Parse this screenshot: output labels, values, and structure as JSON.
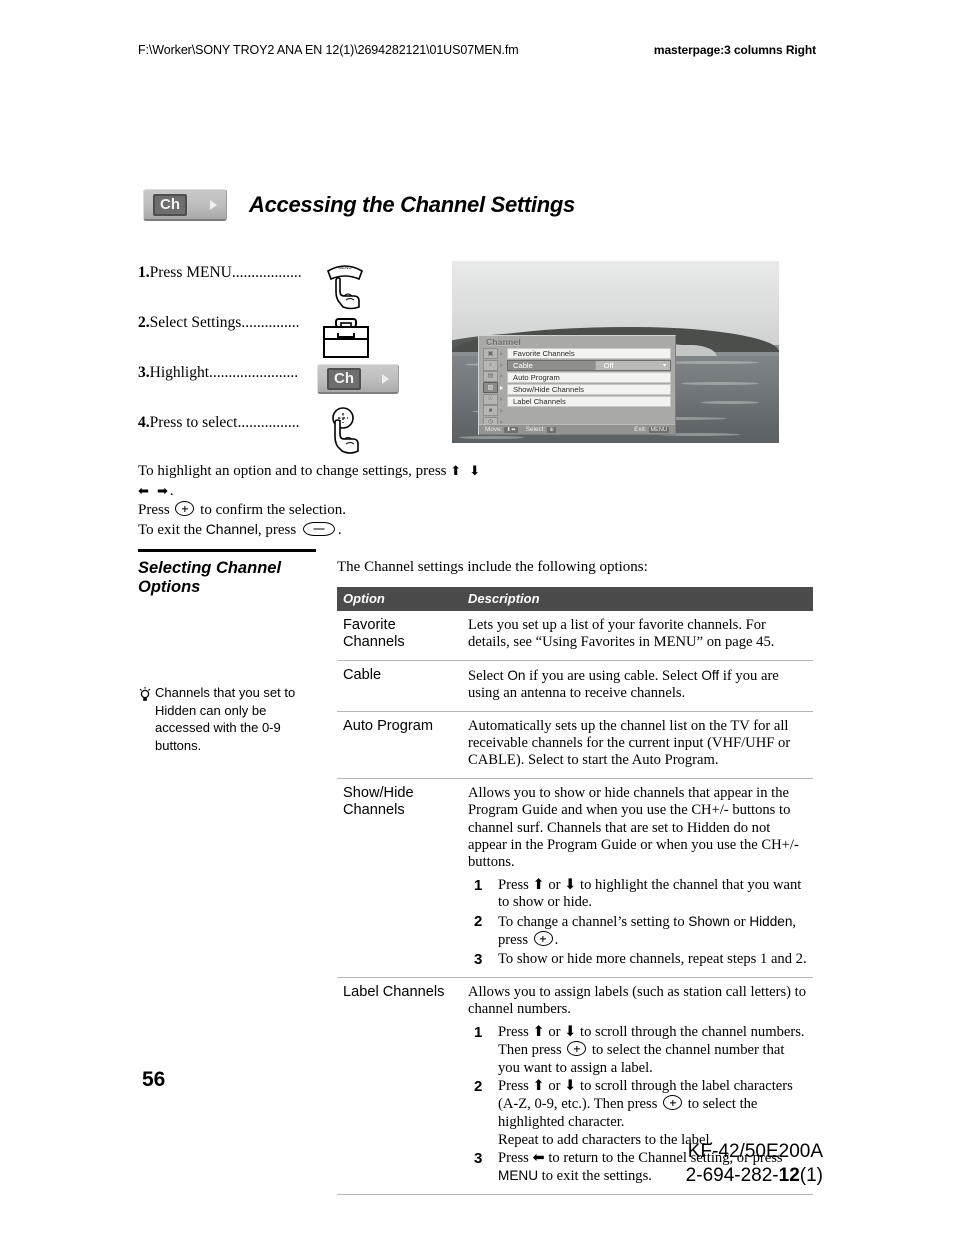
{
  "header": {
    "file_path": "F:\\Worker\\SONY TROY2 ANA EN 12(1)\\2694282121\\01US07MEN.fm",
    "masterpage": "masterpage:3 columns Right"
  },
  "section": {
    "tab_label": "Ch",
    "title": "Accessing the Channel Settings"
  },
  "steps": [
    {
      "num": "1.",
      "text": "Press MENU..................",
      "icon": "hand-pressing-menu-button-icon"
    },
    {
      "num": "2.",
      "text": "Select Settings...............",
      "icon": "toolbox-icon"
    },
    {
      "num": "3.",
      "text": "Highlight.......................",
      "icon": "ch-tab-icon"
    },
    {
      "num": "4.",
      "text": "Press to select................",
      "icon": "hand-pressing-select-button-icon"
    }
  ],
  "tv_screen": {
    "osd": {
      "title": "Channel",
      "rail_icons": [
        "picture-icon",
        "audio-icon",
        "screen-icon",
        "channel-icon",
        "parental-lock-icon",
        "setup-icon",
        "clock-timer-icon"
      ],
      "rail_selected_index": 3,
      "rows": [
        {
          "label": "Favorite Channels",
          "value": "",
          "highlighted": false
        },
        {
          "label": "Cable",
          "value": "Off",
          "highlighted": true
        },
        {
          "label": "Auto Program",
          "value": "",
          "highlighted": false
        },
        {
          "label": "Show/Hide Channels",
          "value": "",
          "highlighted": false
        },
        {
          "label": "Label Channels",
          "value": "",
          "highlighted": false
        }
      ],
      "status_bar": {
        "move": "Move:",
        "move_keys": "⬍⬌",
        "select": "Select:",
        "select_key": "⊕",
        "exit": "Exit:",
        "exit_key": "MENU"
      }
    }
  },
  "instructions": {
    "line1_a": "To highlight an option and to change settings, press ",
    "line1_arrows": "⬆ ⬇ ⬅ ➡",
    "line1_b": ".",
    "line2_a": "Press ",
    "line2_b": " to confirm the selection.",
    "line3_a": "To exit the ",
    "line3_emph": "Channel",
    "line3_b": ", press ",
    "line3_c": "."
  },
  "left_column": {
    "heading": "Selecting Channel Options",
    "tip_icon": "lightbulb-tip-icon",
    "tip_text": "Channels that you set to Hidden can only be accessed with the 0-9 buttons."
  },
  "table_intro": "The Channel settings include the following options:",
  "table": {
    "headers": {
      "option": "Option",
      "description": "Description"
    },
    "rows": [
      {
        "option": "Favorite Channels",
        "description": "Lets you set up a list of your favorite channels. For details, see “Using Favorites in MENU” on page 45.",
        "substeps": []
      },
      {
        "option": "Cable",
        "description_parts": [
          "Select ",
          "On",
          " if you are using cable. Select ",
          "Off",
          " if you are using an antenna to receive channels."
        ],
        "description": "Select On if you are using cable. Select Off if you are using an antenna to receive channels.",
        "substeps": []
      },
      {
        "option": "Auto Program",
        "description": "Automatically sets up the channel list on the TV for all receivable channels for the current input (VHF/UHF or CABLE). Select to start the Auto Program.",
        "substeps": []
      },
      {
        "option": "Show/Hide Channels",
        "description": "Allows you to show or hide channels that appear in the Program Guide and when you use the CH+/- buttons to channel surf. Channels that are set to Hidden do not appear in the Program Guide or when you use the CH+/- buttons.",
        "substeps": [
          {
            "num": "1",
            "text": "Press ⬆ or ⬇ to highlight the channel that you want to show or hide."
          },
          {
            "num": "2",
            "text": "To change a channel’s setting to Shown or Hidden, press ."
          },
          {
            "num": "3",
            "text": "To show or hide more channels, repeat steps 1 and 2."
          }
        ]
      },
      {
        "option": "Label Channels",
        "description": "Allows you to assign labels (such as station call letters) to channel numbers.",
        "substeps": [
          {
            "num": "1",
            "text": "Press ⬆ or ⬇ to scroll through the channel numbers. Then press  to select the channel number that you want to assign a label."
          },
          {
            "num": "2",
            "text": "Press ⬆ or ⬇ to scroll through the label characters (A-Z, 0-9, etc.). Then press  to select the highlighted character.",
            "extra": "Repeat to add characters to the label."
          },
          {
            "num": "3",
            "text": "Press ⬅ to return to the Channel setting, or press MENU to exit the settings."
          }
        ]
      }
    ]
  },
  "footer": {
    "page_number": "56",
    "model": "KF-42/50E200A",
    "part_prefix": "2-694-282-",
    "part_bold": "12",
    "part_suffix": "(1)"
  }
}
